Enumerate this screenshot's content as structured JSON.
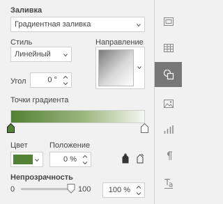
{
  "fill": {
    "label": "Заливка",
    "value": "Градиентная заливка"
  },
  "style": {
    "label": "Стиль",
    "value": "Линейный"
  },
  "direction": {
    "label": "Направление"
  },
  "angle": {
    "label": "Угол",
    "value": "0 °"
  },
  "gradient_points": {
    "label": "Точки градиента",
    "start_color": "#538135",
    "end_color": "#ffffff"
  },
  "color": {
    "label": "Цвет",
    "swatch": "#538135"
  },
  "position": {
    "label": "Положение",
    "value": "0 %"
  },
  "opacity": {
    "label": "Непрозрачность",
    "min": "0",
    "max": "100",
    "value": "100 %",
    "level": 100
  },
  "sidebar": {
    "items": [
      {
        "icon": "slide-settings-icon"
      },
      {
        "icon": "table-settings-icon"
      },
      {
        "icon": "shape-settings-icon",
        "active": true
      },
      {
        "icon": "image-settings-icon"
      },
      {
        "icon": "chart-settings-icon"
      },
      {
        "icon": "paragraph-settings-icon"
      },
      {
        "icon": "text-art-settings-icon"
      }
    ]
  }
}
